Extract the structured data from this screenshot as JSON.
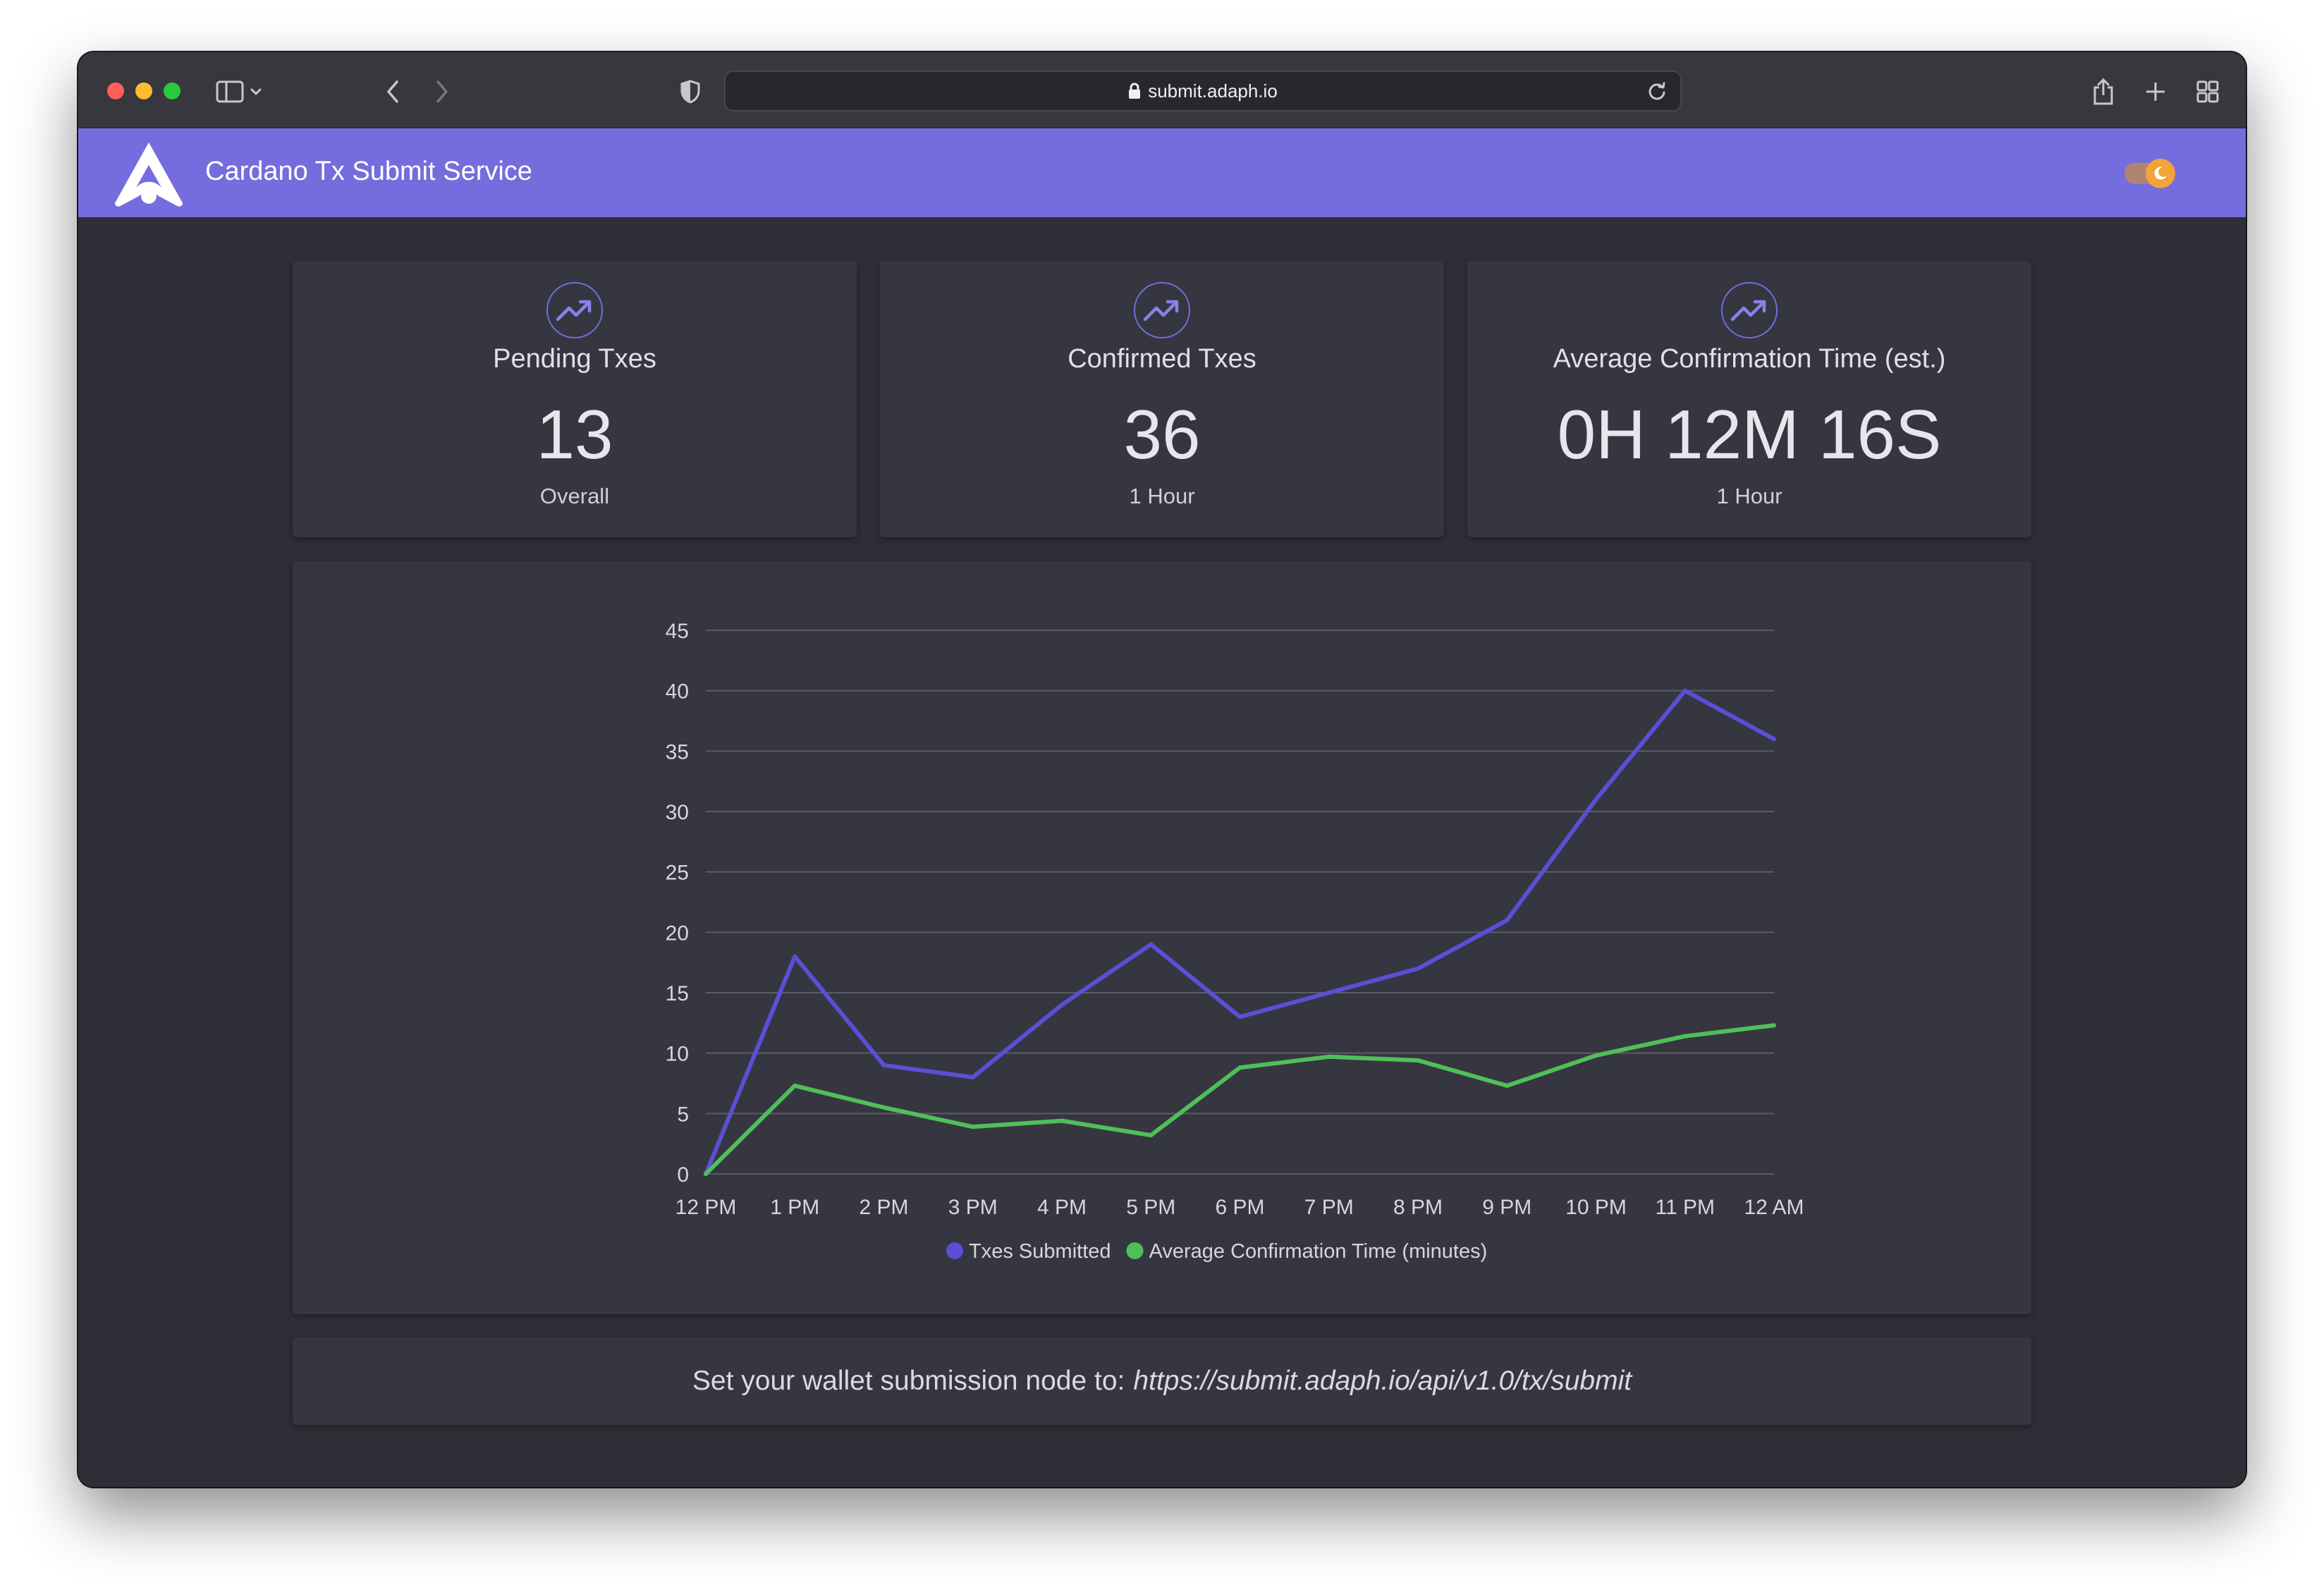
{
  "browser": {
    "url": "submit.adaph.io"
  },
  "app": {
    "title": "Cardano Tx Submit Service",
    "accent": "#756ddd",
    "logo_icon": "adaph-logo-icon",
    "theme_toggle_icon": "moon-icon"
  },
  "stats": [
    {
      "label": "Pending Txes",
      "value": "13",
      "sub": "Overall",
      "icon": "trending-up-icon"
    },
    {
      "label": "Confirmed Txes",
      "value": "36",
      "sub": "1 Hour",
      "icon": "trending-up-icon"
    },
    {
      "label": "Average Confirmation Time (est.)",
      "value": "0H 12M 16S",
      "sub": "1 Hour",
      "icon": "trending-up-icon"
    }
  ],
  "chart_data": {
    "type": "line",
    "categories": [
      "12 PM",
      "1 PM",
      "2 PM",
      "3 PM",
      "4 PM",
      "5 PM",
      "6 PM",
      "7 PM",
      "8 PM",
      "9 PM",
      "10 PM",
      "11 PM",
      "12 AM"
    ],
    "series": [
      {
        "name": "Txes Submitted",
        "color": "#5a4fd6",
        "values": [
          0,
          18,
          9,
          8,
          14,
          19,
          13,
          15,
          17,
          21,
          31,
          40,
          36
        ]
      },
      {
        "name": "Average Confirmation Time (minutes)",
        "color": "#4fbf5a",
        "values": [
          0,
          7.3,
          5.5,
          3.9,
          4.4,
          3.2,
          8.8,
          9.7,
          9.4,
          7.3,
          9.8,
          11.4,
          12.3
        ]
      }
    ],
    "ylim": [
      0,
      45
    ],
    "yticks": [
      0,
      5,
      10,
      15,
      20,
      25,
      30,
      35,
      40,
      45
    ],
    "grid": true,
    "legend_position": "bottom-center"
  },
  "footer": {
    "message": "Set your wallet submission node to:",
    "endpoint": "https://submit.adaph.io/api/v1.0/tx/submit"
  }
}
